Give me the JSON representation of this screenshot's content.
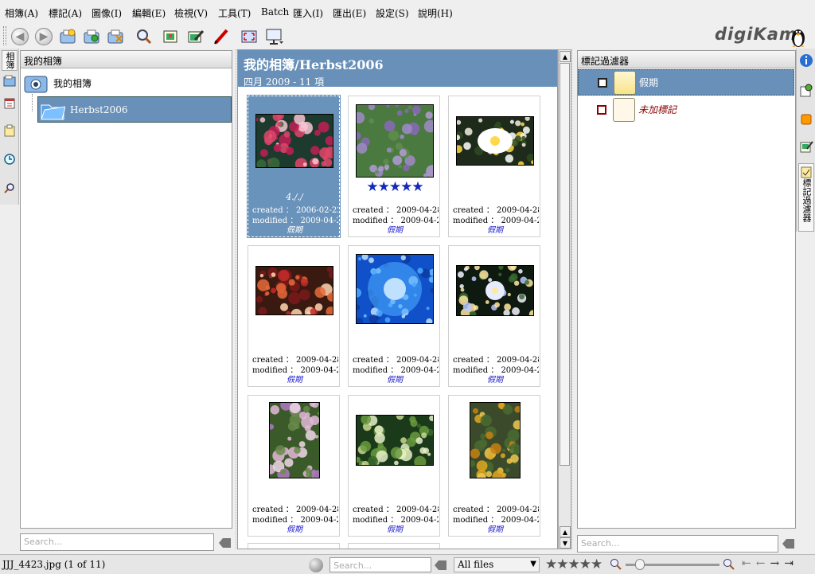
{
  "menu": [
    "相簿(A)",
    "標記(A)",
    "圖像(I)",
    "編輯(E)",
    "檢視(V)",
    "工具(T)",
    "Batch",
    "匯入(I)",
    "匯出(E)",
    "設定(S)",
    "說明(H)"
  ],
  "app_logo": "digiKam",
  "left_sidebar": {
    "tabs": [
      {
        "label": "相簿",
        "icon": "albums-icon"
      },
      {
        "label": "",
        "icon": "calendar-icon"
      },
      {
        "label": "",
        "icon": "tags-icon"
      },
      {
        "label": "",
        "icon": "timeline-icon"
      },
      {
        "label": "",
        "icon": "search-icon"
      }
    ],
    "panel_title": "我的相簿",
    "root_label": "我的相簿",
    "album_label": "Herbst2006",
    "search_placeholder": "Search..."
  },
  "center": {
    "title": "我的相簿/Herbst2006",
    "subtitle": "四月 2009 - 11 項",
    "items": [
      {
        "name": "4././",
        "stars": 0,
        "created": "created ： 2006-02-22...",
        "modified": "modified ： 2009-04-2...",
        "tag": "假期",
        "selected": true,
        "palette": "bleeding"
      },
      {
        "name": "",
        "stars": 5,
        "created": "created ： 2009-04-28...",
        "modified": "modified ： 2009-04-2...",
        "tag": "假期",
        "selected": false,
        "palette": "lavender"
      },
      {
        "name": "",
        "stars": 0,
        "created": "created ： 2009-04-28...",
        "modified": "modified ： 2009-04-2...",
        "tag": "假期",
        "selected": false,
        "palette": "lotus"
      },
      {
        "name": "",
        "stars": 0,
        "created": "created ： 2009-04-28...",
        "modified": "modified ： 2009-04-2...",
        "tag": "假期",
        "selected": false,
        "palette": "flowerbed"
      },
      {
        "name": "",
        "stars": 0,
        "created": "created ： 2009-04-28...",
        "modified": "modified ： 2009-04-2...",
        "tag": "假期",
        "selected": false,
        "palette": "dahlia"
      },
      {
        "name": "",
        "stars": 0,
        "created": "created ： 2009-04-28...",
        "modified": "modified ： 2009-04-2...",
        "tag": "假期",
        "selected": false,
        "palette": "columbine"
      },
      {
        "name": "",
        "stars": 0,
        "created": "created ： 2009-04-28...",
        "modified": "modified ： 2009-04-2...",
        "tag": "假期",
        "selected": false,
        "palette": "lupine"
      },
      {
        "name": "",
        "stars": 0,
        "created": "created ： 2009-04-28...",
        "modified": "modified ： 2009-04-2...",
        "tag": "假期",
        "selected": false,
        "palette": "hosta"
      },
      {
        "name": "",
        "stars": 0,
        "created": "created ： 2009-04-28...",
        "modified": "modified ： 2009-04-2...",
        "tag": "假期",
        "selected": false,
        "palette": "tansy"
      }
    ]
  },
  "right_sidebar": {
    "panel_title": "標記過濾器",
    "tags": [
      {
        "label": "假期",
        "selected": true,
        "italic": false
      },
      {
        "label": "未加標記",
        "selected": false,
        "italic": true
      }
    ],
    "search_placeholder": "Search...",
    "tabs": [
      {
        "label": "",
        "icon": "info-icon"
      },
      {
        "label": "",
        "icon": "geolocation-icon"
      },
      {
        "label": "",
        "icon": "color-icon"
      },
      {
        "label": "",
        "icon": "tag-edit-icon"
      },
      {
        "label": "標記過濾器",
        "icon": "tag-filter-icon"
      }
    ]
  },
  "status": {
    "file": "JJJ_4423.jpg",
    "position": "(1 of 11)",
    "search_placeholder": "Search...",
    "filter": "All files",
    "rating_stars": 5
  },
  "colors": {
    "selection": "#6890b8",
    "stars": "#1428b8",
    "tag_text": "#2222cc",
    "untagged": "#8b0000"
  }
}
